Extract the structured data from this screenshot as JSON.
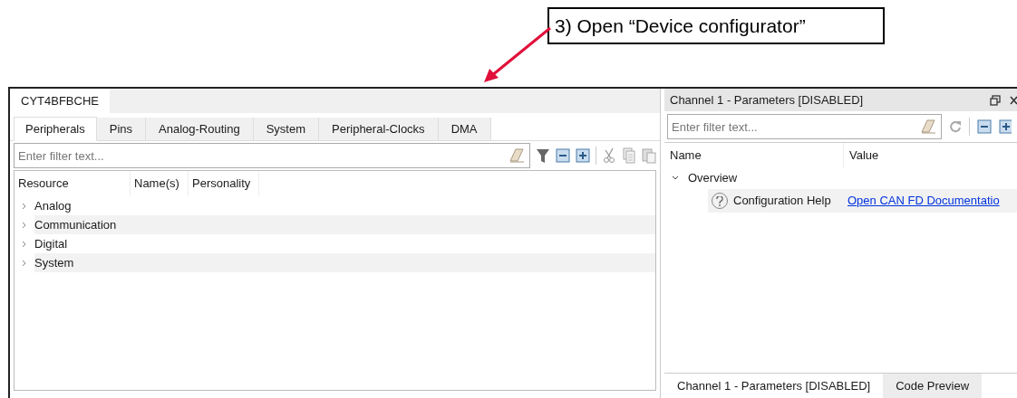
{
  "annotation": {
    "text": "3) Open “Device configurator”"
  },
  "left_panel": {
    "title_tab": "CYT4BFBCHE",
    "tabs": [
      {
        "label": "Peripherals",
        "selected": true
      },
      {
        "label": "Pins",
        "selected": false
      },
      {
        "label": "Analog-Routing",
        "selected": false
      },
      {
        "label": "System",
        "selected": false
      },
      {
        "label": "Peripheral-Clocks",
        "selected": false
      },
      {
        "label": "DMA",
        "selected": false
      }
    ],
    "filter": {
      "placeholder": "Enter filter text..."
    },
    "columns": [
      "Resource",
      "Name(s)",
      "Personality"
    ],
    "rows": [
      {
        "label": "Analog",
        "expanded": false
      },
      {
        "label": "Communication",
        "expanded": false
      },
      {
        "label": "Digital",
        "expanded": false
      },
      {
        "label": "System",
        "expanded": false
      }
    ]
  },
  "right_panel": {
    "title": "Channel 1 - Parameters [DISABLED]",
    "filter": {
      "placeholder": "Enter filter text..."
    },
    "columns": [
      "Name",
      "Value"
    ],
    "tree": [
      {
        "label": "Overview",
        "expanded": true,
        "children": [
          {
            "name": "Configuration Help",
            "value": "Open CAN FD Documentatio"
          }
        ]
      }
    ],
    "bottom_tabs": [
      {
        "label": "Channel 1 - Parameters [DISABLED]",
        "selected": true
      },
      {
        "label": "Code Preview",
        "selected": false
      }
    ]
  }
}
